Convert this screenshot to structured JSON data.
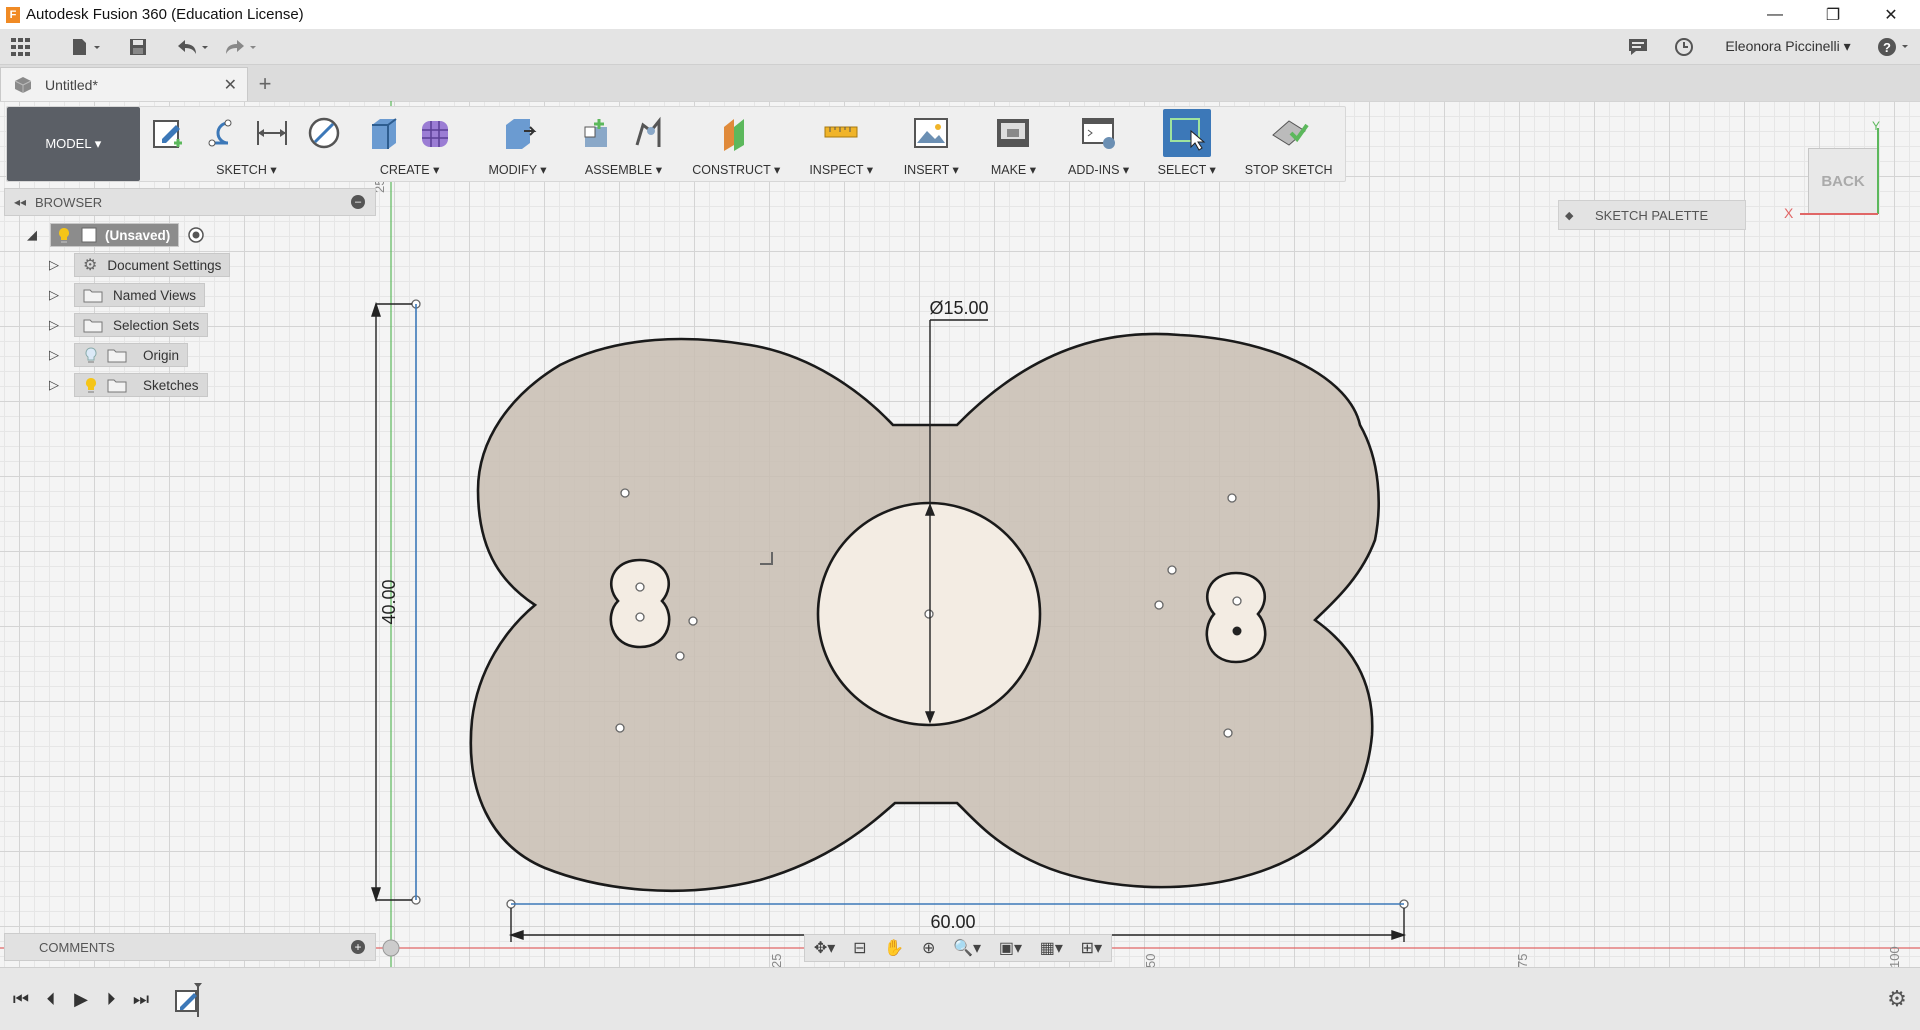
{
  "window": {
    "title": "Autodesk Fusion 360 (Education License)",
    "minimize": "—",
    "restore": "❐",
    "close": "✕"
  },
  "appbar": {
    "user": "Eleonora Piccinelli ▾",
    "help": "?▾"
  },
  "tab": {
    "label": "Untitled*",
    "close": "✕",
    "new": "+"
  },
  "toolbar": {
    "workspace": "MODEL ▾",
    "groups": {
      "sketch": "SKETCH ▾",
      "create": "CREATE ▾",
      "modify": "MODIFY ▾",
      "assemble": "ASSEMBLE ▾",
      "construct": "CONSTRUCT ▾",
      "inspect": "INSPECT ▾",
      "insert": "INSERT ▾",
      "make": "MAKE ▾",
      "addins": "ADD-INS ▾",
      "select": "SELECT ▾",
      "stop": "STOP SKETCH"
    }
  },
  "browser": {
    "title": "BROWSER",
    "root": "(Unsaved)",
    "items": [
      {
        "label": "Document Settings",
        "icon": "gear-icon"
      },
      {
        "label": "Named Views",
        "icon": "folder-icon"
      },
      {
        "label": "Selection Sets",
        "icon": "folder-icon"
      },
      {
        "label": "Origin",
        "icon": "folder-icon"
      },
      {
        "label": "Sketches",
        "icon": "folder-icon"
      }
    ]
  },
  "comments": {
    "title": "COMMENTS"
  },
  "palette": {
    "title": "SKETCH PALETTE"
  },
  "viewcube": {
    "face": "BACK",
    "axis_x": "X",
    "axis_y": "Y"
  },
  "sketch": {
    "dim_diameter": "Ø15.00",
    "dim_height": "40.00",
    "dim_width": "60.00",
    "ruler_top": "25",
    "ruler_bottom": [
      "25",
      "50",
      "75",
      "100"
    ]
  },
  "colors": {
    "sketch_fill": "#c8bdb2",
    "hole_fill": "#f3ece3",
    "accent": "#3c78b8",
    "axis_red": "#e06666",
    "axis_green": "#5cb85c"
  }
}
